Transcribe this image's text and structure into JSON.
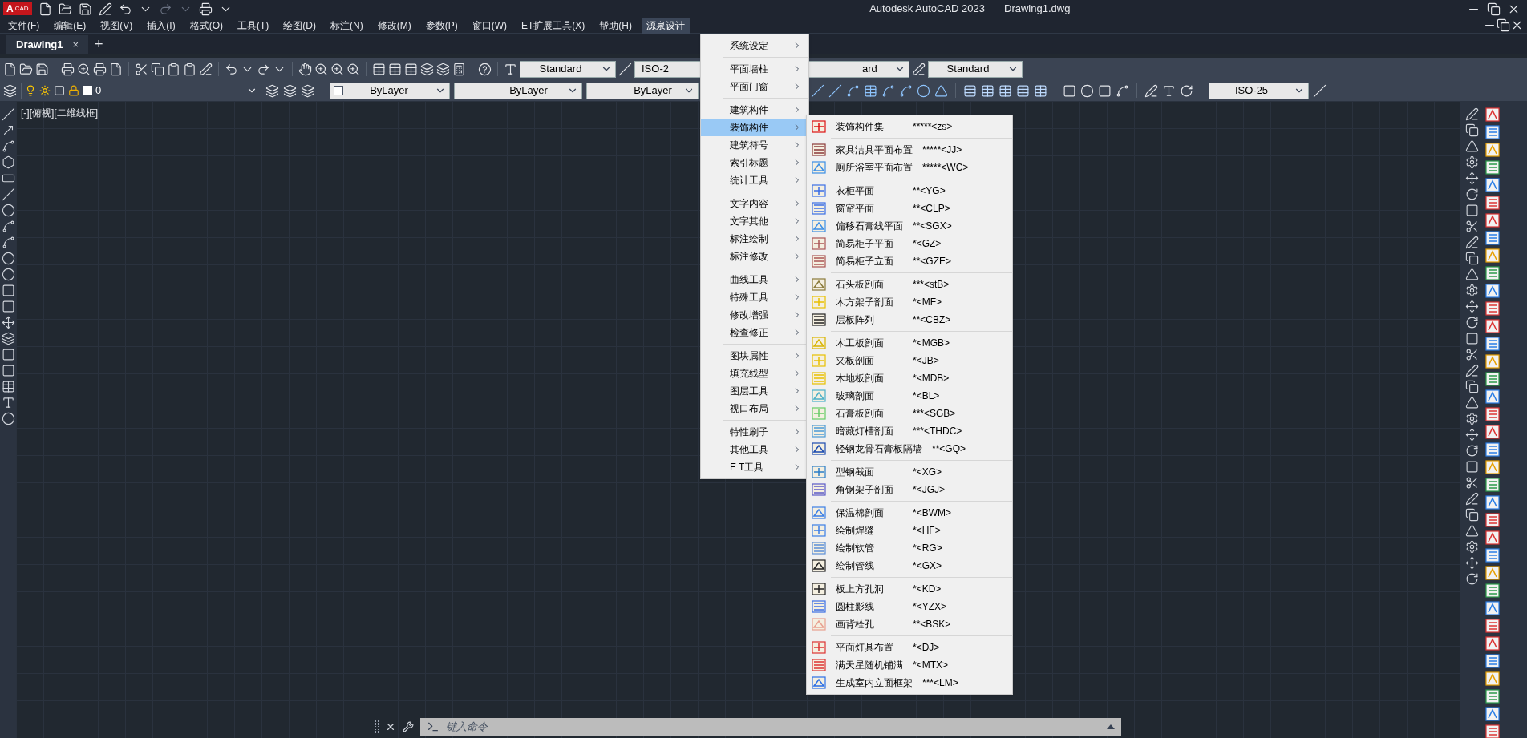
{
  "app_logo": {
    "letter": "A",
    "text": "CAD"
  },
  "window": {
    "title": "Autodesk AutoCAD 2023",
    "document": "Drawing1.dwg"
  },
  "menu_bar": [
    {
      "label": "文件(F)",
      "selected": false
    },
    {
      "label": "编辑(E)",
      "selected": false
    },
    {
      "label": "视图(V)",
      "selected": false
    },
    {
      "label": "插入(I)",
      "selected": false
    },
    {
      "label": "格式(O)",
      "selected": false
    },
    {
      "label": "工具(T)",
      "selected": false
    },
    {
      "label": "绘图(D)",
      "selected": false
    },
    {
      "label": "标注(N)",
      "selected": false
    },
    {
      "label": "修改(M)",
      "selected": false
    },
    {
      "label": "参数(P)",
      "selected": false
    },
    {
      "label": "窗口(W)",
      "selected": false
    },
    {
      "label": "ET扩展工具(X)",
      "selected": false
    },
    {
      "label": "帮助(H)",
      "selected": false
    },
    {
      "label": "源泉设计",
      "selected": true
    }
  ],
  "tabs": [
    {
      "label": "Drawing1",
      "selected": true,
      "close": "×"
    }
  ],
  "new_tab": "+",
  "toolbar_1": {
    "text_style": "Standard",
    "dim_style": "ISO-2",
    "table_style": "ard",
    "multileader_style": "Standard"
  },
  "toolbar_2": {
    "layer": "0",
    "object_color": "ByLayer",
    "linetype": "ByLayer",
    "lineweight": "ByLayer",
    "dim_style": "ISO-25"
  },
  "viewport_label": "[-][俯视][二维线框]",
  "menu": {
    "groups": [
      [
        {
          "label": "系统设定",
          "selected": false
        }
      ],
      [
        {
          "label": "平面墙柱",
          "selected": false
        },
        {
          "label": "平面门窗",
          "selected": false
        }
      ],
      [
        {
          "label": "建筑构件",
          "selected": false
        },
        {
          "label": "装饰构件",
          "selected": true
        },
        {
          "label": "建筑符号",
          "selected": false
        },
        {
          "label": "索引标题",
          "selected": false
        },
        {
          "label": "统计工具",
          "selected": false
        }
      ],
      [
        {
          "label": "文字内容",
          "selected": false
        },
        {
          "label": "文字其他",
          "selected": false
        },
        {
          "label": "标注绘制",
          "selected": false
        },
        {
          "label": "标注修改",
          "selected": false
        }
      ],
      [
        {
          "label": "曲线工具",
          "selected": false
        },
        {
          "label": "特殊工具",
          "selected": false
        },
        {
          "label": "修改增强",
          "selected": false
        },
        {
          "label": "检查修正",
          "selected": false
        }
      ],
      [
        {
          "label": "图块属性",
          "selected": false
        },
        {
          "label": "填充线型",
          "selected": false
        },
        {
          "label": "图层工具",
          "selected": false
        },
        {
          "label": "视口布局",
          "selected": false
        }
      ],
      [
        {
          "label": "特性刷子",
          "selected": false
        },
        {
          "label": "其他工具",
          "selected": false
        },
        {
          "label": "E T工具",
          "selected": false
        }
      ]
    ]
  },
  "submenu": {
    "groups": [
      [
        {
          "label": "装饰构件集",
          "shortcut": "*****<zs>"
        }
      ],
      [
        {
          "label": "家具洁具平面布置",
          "shortcut": "*****<JJ>"
        },
        {
          "label": "厕所浴室平面布置",
          "shortcut": "*****<WC>"
        }
      ],
      [
        {
          "label": "衣柜平面",
          "shortcut": "**<YG>"
        },
        {
          "label": "窗帘平面",
          "shortcut": "**<CLP>"
        },
        {
          "label": "偏移石膏线平面",
          "shortcut": "**<SGX>"
        },
        {
          "label": "简易柜子平面",
          "shortcut": "*<GZ>"
        },
        {
          "label": "简易柜子立面",
          "shortcut": "**<GZE>"
        }
      ],
      [
        {
          "label": "石头板剖面",
          "shortcut": "***<stB>"
        },
        {
          "label": "木方架子剖面",
          "shortcut": "*<MF>"
        },
        {
          "label": "层板阵列",
          "shortcut": "**<CBZ>"
        }
      ],
      [
        {
          "label": "木工板剖面",
          "shortcut": "*<MGB>"
        },
        {
          "label": "夹板剖面",
          "shortcut": "*<JB>"
        },
        {
          "label": "木地板剖面",
          "shortcut": "*<MDB>"
        },
        {
          "label": "玻璃剖面",
          "shortcut": "*<BL>"
        },
        {
          "label": "石膏板剖面",
          "shortcut": "***<SGB>"
        },
        {
          "label": "暗藏灯槽剖面",
          "shortcut": "***<THDC>"
        },
        {
          "label": "轻钢龙骨石膏板隔墙",
          "shortcut": "**<GQ>"
        }
      ],
      [
        {
          "label": "型钢截面",
          "shortcut": "*<XG>"
        },
        {
          "label": "角钢架子剖面",
          "shortcut": "*<JGJ>"
        }
      ],
      [
        {
          "label": "保温棉剖面",
          "shortcut": "*<BWM>"
        },
        {
          "label": "绘制焊缝",
          "shortcut": "*<HF>"
        },
        {
          "label": "绘制软管",
          "shortcut": "*<RG>"
        },
        {
          "label": "绘制管线",
          "shortcut": "*<GX>"
        }
      ],
      [
        {
          "label": "板上方孔洞",
          "shortcut": "*<KD>"
        },
        {
          "label": "圆柱影线",
          "shortcut": "*<YZX>"
        },
        {
          "label": "画背栓孔",
          "shortcut": "**<BSK>"
        }
      ],
      [
        {
          "label": "平面灯具布置",
          "shortcut": "*<DJ>"
        },
        {
          "label": "满天星随机铺满",
          "shortcut": "*<MTX>"
        },
        {
          "label": "生成室内立面框架",
          "shortcut": "***<LM>"
        }
      ]
    ]
  },
  "command_line": {
    "placeholder": "键入命令"
  }
}
